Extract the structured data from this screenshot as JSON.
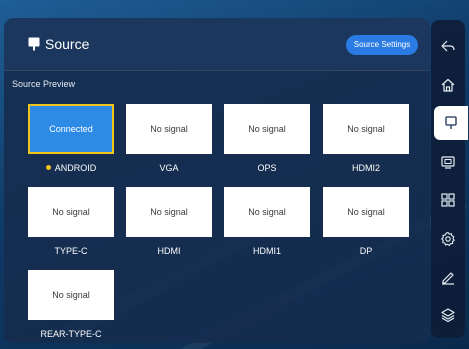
{
  "header": {
    "title": "Source",
    "settings_label": "Source Settings"
  },
  "section_label": "Source Preview",
  "sources": [
    {
      "name": "ANDROID",
      "status": "Connected",
      "active": true
    },
    {
      "name": "VGA",
      "status": "No signal",
      "active": false
    },
    {
      "name": "OPS",
      "status": "No signal",
      "active": false
    },
    {
      "name": "HDMI2",
      "status": "No signal",
      "active": false
    },
    {
      "name": "TYPE-C",
      "status": "No signal",
      "active": false
    },
    {
      "name": "HDMI",
      "status": "No signal",
      "active": false
    },
    {
      "name": "HDMI1",
      "status": "No signal",
      "active": false
    },
    {
      "name": "DP",
      "status": "No signal",
      "active": false
    },
    {
      "name": "REAR-TYPE-C",
      "status": "No signal",
      "active": false
    }
  ],
  "sidebar": {
    "items": [
      {
        "icon": "back-icon"
      },
      {
        "icon": "home-icon"
      },
      {
        "icon": "source-icon",
        "active": true
      },
      {
        "icon": "screen-icon"
      },
      {
        "icon": "apps-grid-icon"
      },
      {
        "icon": "settings-gear-icon"
      },
      {
        "icon": "annotate-pen-icon"
      },
      {
        "icon": "layers-icon"
      }
    ]
  },
  "colors": {
    "accent": "#2b7be4",
    "connected_tile": "#2d8be6",
    "active_border": "#f0c419",
    "panel": "#162d4e"
  }
}
